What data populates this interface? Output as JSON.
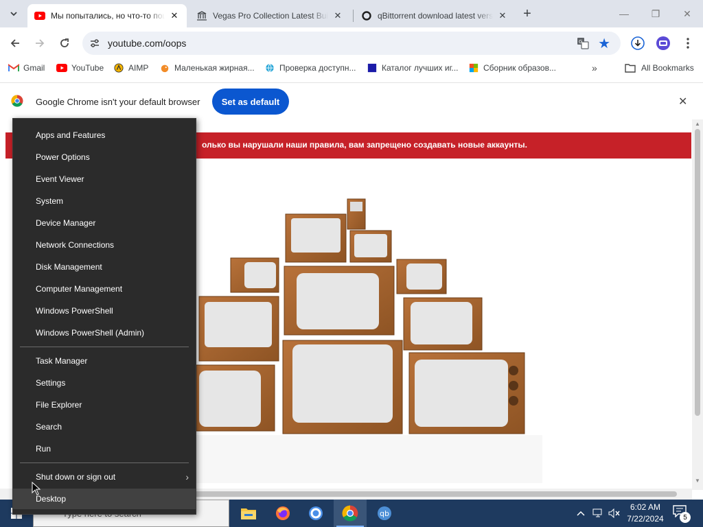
{
  "tabs": [
    {
      "title": "Мы попытались, но что-то пошло не так",
      "favicon": "youtube-icon",
      "active": true
    },
    {
      "title": "Vegas Pro Collection Latest Build",
      "favicon": "library-icon",
      "active": false
    },
    {
      "title": "qBittorrent download latest version",
      "favicon": "circle-icon",
      "active": false
    }
  ],
  "toolbar": {
    "url": "youtube.com/oops"
  },
  "bookmarks": {
    "items": [
      {
        "label": "Gmail",
        "icon": "gmail-icon"
      },
      {
        "label": "YouTube",
        "icon": "youtube-icon"
      },
      {
        "label": "AIMP",
        "icon": "aimp-icon"
      },
      {
        "label": "Маленькая жирная...",
        "icon": "bird-icon"
      },
      {
        "label": "Проверка доступн...",
        "icon": "globe-icon"
      },
      {
        "label": "Каталог лучших иг...",
        "icon": "catalog-icon"
      },
      {
        "label": "Сборник образов...",
        "icon": "ms-icon"
      }
    ],
    "all_label": "All Bookmarks"
  },
  "infobar": {
    "message": "Google Chrome isn't your default browser",
    "button": "Set as default"
  },
  "page": {
    "banner_text": "олько вы нарушали наши правила, вам запрещено создавать новые аккаунты."
  },
  "context_menu": {
    "group1": [
      "Apps and Features",
      "Power Options",
      "Event Viewer",
      "System",
      "Device Manager",
      "Network Connections",
      "Disk Management",
      "Computer Management",
      "Windows PowerShell",
      "Windows PowerShell (Admin)"
    ],
    "group2": [
      "Task Manager",
      "Settings",
      "File Explorer",
      "Search",
      "Run"
    ],
    "group3": [
      "Shut down or sign out",
      "Desktop"
    ]
  },
  "taskbar": {
    "search_placeholder": "Type here to search",
    "time": "6:02 AM",
    "date": "7/22/2024",
    "notification_count": "5"
  },
  "colors": {
    "accent": "#0b57d0",
    "banner": "#c62128",
    "menu_bg": "#2b2b2b",
    "taskbar": "#1e3a5f"
  }
}
